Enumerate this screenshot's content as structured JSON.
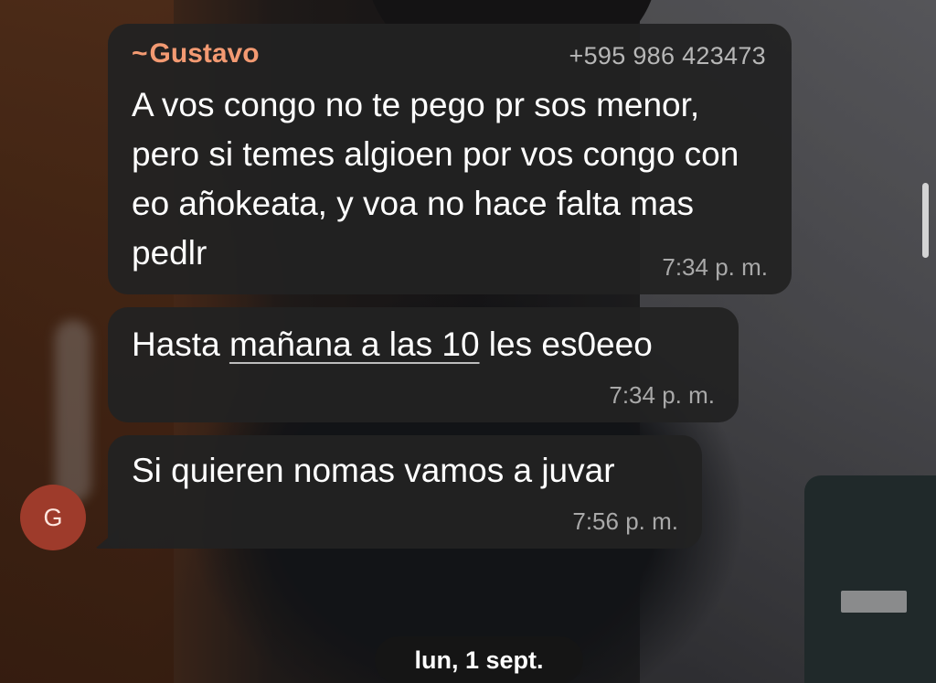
{
  "messages": [
    {
      "sender_name": "Gustavo",
      "sender_prefix": "~",
      "sender_phone": "+595 986 423473",
      "text": "A vos  congo no te pego  pr sos menor, pero si temes algioen por vos congo con eo añokeata, y voa no hace falta mas pedlr",
      "time": "7:34 p. m."
    },
    {
      "text_before": "Hasta ",
      "text_link": "mañana a las 10",
      "text_after": " les es0eeo",
      "time": "7:34 p. m."
    },
    {
      "text": "Si quieren nomas vamos a juvar",
      "time": "7:56 p. m."
    }
  ],
  "avatar": {
    "initial": "G",
    "color": "#9e3b2b"
  },
  "date_separator": "lun, 1 sept.",
  "colors": {
    "sender_name": "#f39a72",
    "bubble": "#222222",
    "timestamp": "#a9a9a9"
  }
}
